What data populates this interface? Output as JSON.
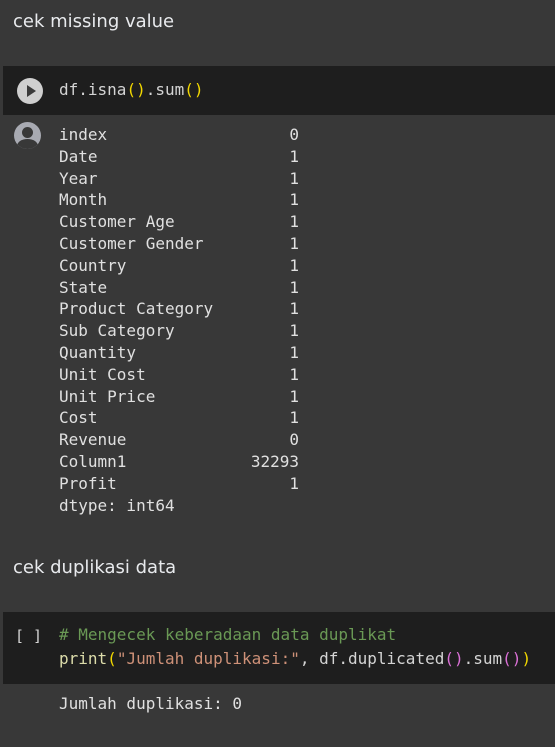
{
  "sections": [
    {
      "heading": "cek missing value"
    },
    {
      "heading": "cek duplikasi data"
    }
  ],
  "cell1": {
    "code_prefix": "df.isna",
    "code_mid": ".sum",
    "open": "(",
    "close": ")"
  },
  "cell1_output": {
    "rows": [
      {
        "k": "index",
        "v": "0"
      },
      {
        "k": "Date",
        "v": "1"
      },
      {
        "k": "Year",
        "v": "1"
      },
      {
        "k": "Month",
        "v": "1"
      },
      {
        "k": "Customer Age",
        "v": "1"
      },
      {
        "k": "Customer Gender",
        "v": "1"
      },
      {
        "k": "Country",
        "v": "1"
      },
      {
        "k": "State",
        "v": "1"
      },
      {
        "k": "Product Category",
        "v": "1"
      },
      {
        "k": "Sub Category",
        "v": "1"
      },
      {
        "k": "Quantity",
        "v": "1"
      },
      {
        "k": "Unit Cost",
        "v": "1"
      },
      {
        "k": "Unit Price",
        "v": "1"
      },
      {
        "k": "Cost",
        "v": "1"
      },
      {
        "k": "Revenue",
        "v": "0"
      },
      {
        "k": "Column1",
        "v": "32293"
      },
      {
        "k": "Profit",
        "v": "1"
      }
    ],
    "dtype": "dtype: int64"
  },
  "cell2": {
    "bracket": "[ ]",
    "comment": "# Mengecek keberadaan data duplikat",
    "print_fn": "print",
    "string": "\"Jumlah duplikasi:\"",
    "comma_var": ", df.duplicated",
    "sum": ".sum"
  },
  "cell2_output": {
    "text": "Jumlah duplikasi: 0"
  },
  "icons": {
    "run": "play-icon",
    "output": "user-avatar-icon"
  }
}
